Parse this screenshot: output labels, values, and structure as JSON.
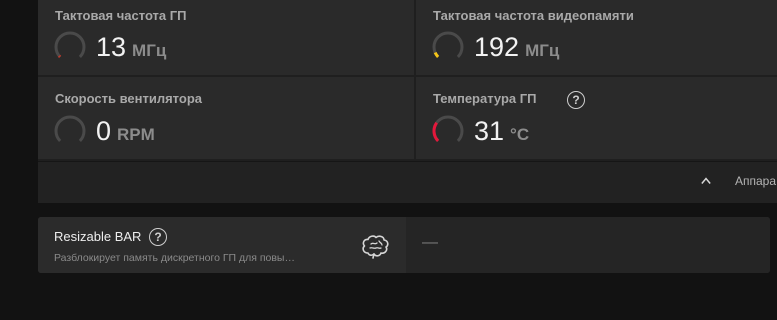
{
  "metrics": {
    "gpu_clock": {
      "title": "Тактовая частота ГП",
      "value": "13",
      "unit": "МГц",
      "gauge_level": 0.02,
      "gauge_color": "#c0392b"
    },
    "vram_clock": {
      "title": "Тактовая частота видеопамяти",
      "value": "192",
      "unit": "МГц",
      "gauge_level": 0.08,
      "gauge_color": "#f5c518"
    },
    "fan_speed": {
      "title": "Скорость вентилятора",
      "value": "0",
      "unit": "RPM",
      "gauge_level": 0.0,
      "gauge_color": "#e0e0e0"
    },
    "gpu_temp": {
      "title": "Температура ГП",
      "value": "31",
      "unit": "°C",
      "gauge_level": 0.3,
      "gauge_color": "#e4173b"
    }
  },
  "footer": {
    "label": "Аппара"
  },
  "resizable_bar": {
    "title": "Resizable BAR",
    "description": "Разблокирует память дискретного ГП для повы…",
    "value": "—"
  },
  "colors": {
    "gauge_track": "#4a4a4a",
    "background": "#121212"
  }
}
